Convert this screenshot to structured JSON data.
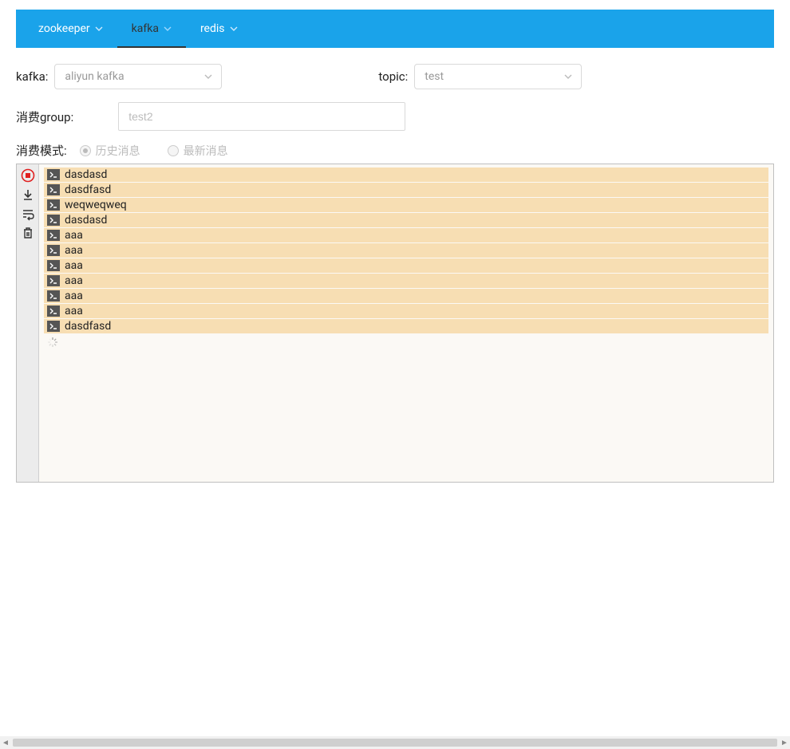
{
  "nav": {
    "items": [
      {
        "label": "zookeeper",
        "active": false
      },
      {
        "label": "kafka",
        "active": true
      },
      {
        "label": "redis",
        "active": false
      }
    ]
  },
  "form": {
    "kafka_label": "kafka:",
    "kafka_value": "aliyun kafka",
    "topic_label": "topic:",
    "topic_value": "test",
    "group_label": "消费group:",
    "group_placeholder": "test2",
    "mode_label": "消费模式:",
    "mode_options": [
      {
        "label": "历史消息",
        "selected": true
      },
      {
        "label": "最新消息",
        "selected": false
      }
    ]
  },
  "toolbar_icons": [
    "stop",
    "scroll-down",
    "wrap",
    "trash"
  ],
  "logs": [
    "dasdasd",
    "dasdfasd",
    "weqweqweq",
    "dasdasd",
    "aaa",
    "aaa",
    "aaa",
    "aaa",
    "aaa",
    "aaa",
    "dasdfasd"
  ]
}
